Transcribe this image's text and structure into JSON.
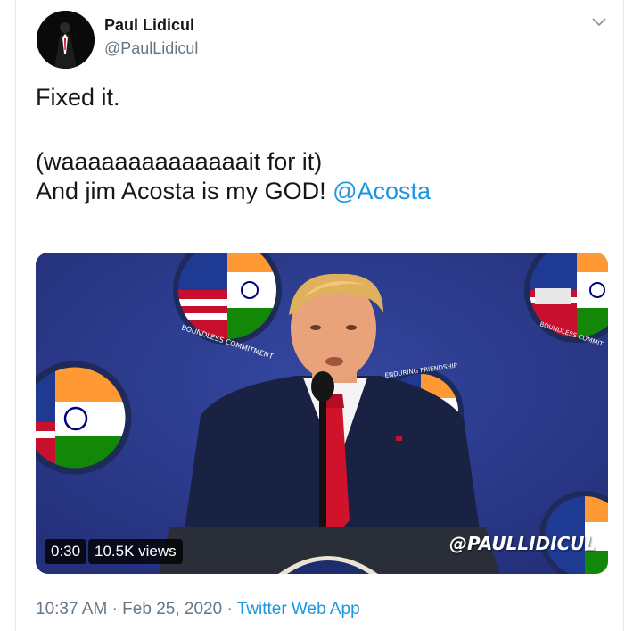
{
  "author": {
    "name": "Paul Lidicul",
    "handle": "@PaulLidicul"
  },
  "tweet": {
    "line1": "Fixed it.",
    "line2": "(waaaaaaaaaaaaaait for it)",
    "line3_prefix": "And jim Acosta is my GOD! ",
    "mention": "@Acosta"
  },
  "video": {
    "duration": "0:30",
    "views": "10.5K views",
    "watermark": "@PAULLIDICUL",
    "seal_text_top": "BOUNDLESS COMMITMENT",
    "seal_text_friendship": "ENDURING FRIENDSHIP"
  },
  "meta": {
    "time": "10:37 AM",
    "separator": "·",
    "date": "Feb 25, 2020",
    "app": "Twitter Web App"
  },
  "icons": {
    "caret": "chevron-down-icon"
  },
  "colors": {
    "link": "#1b95e0",
    "muted": "#657786",
    "text": "#14171a",
    "backdrop": "#2c3a86"
  }
}
